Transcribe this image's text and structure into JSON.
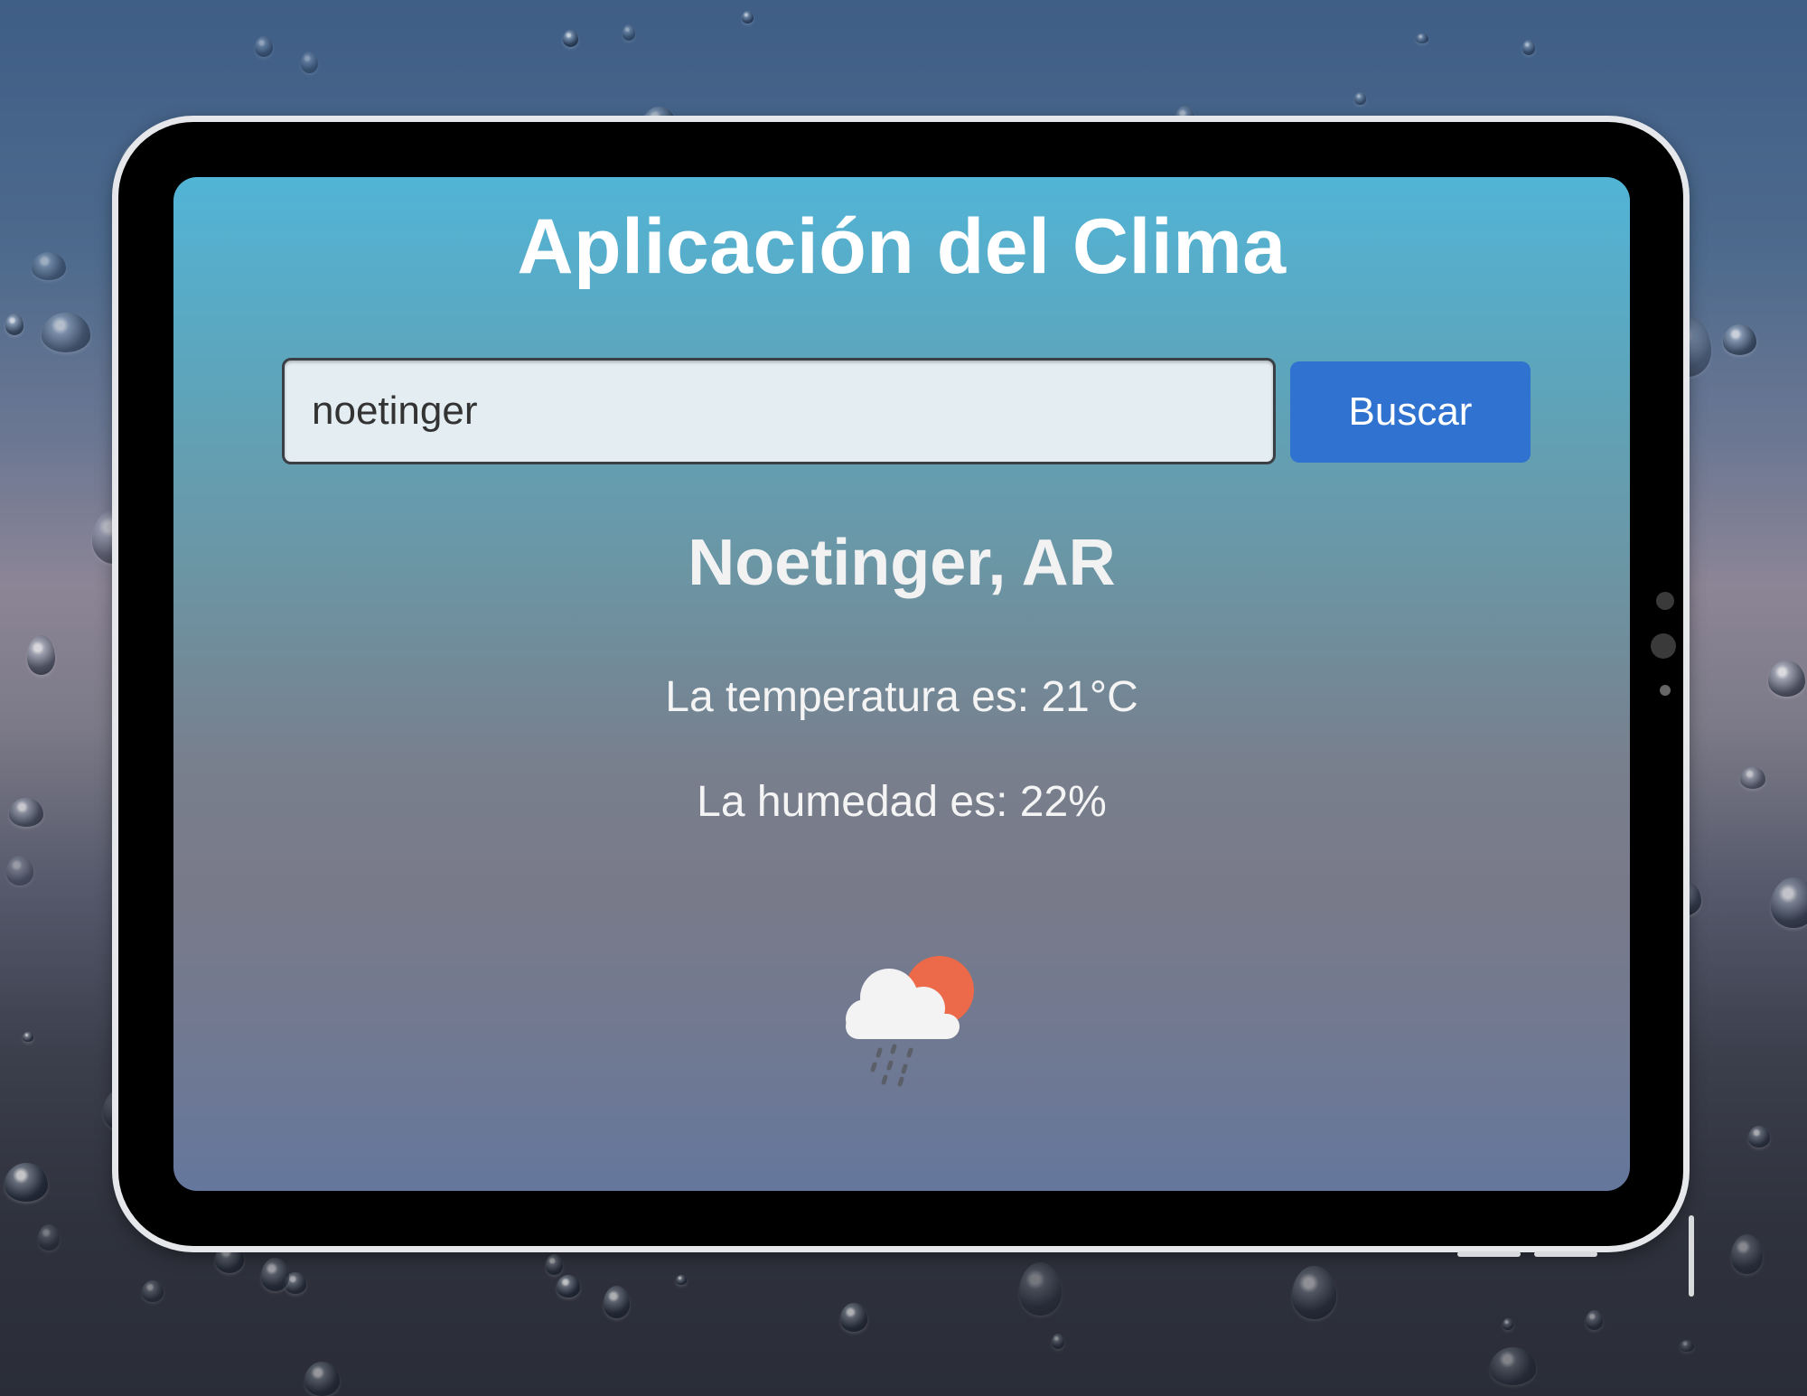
{
  "app": {
    "title": "Aplicación del Clima"
  },
  "search": {
    "value": "noetinger",
    "button_label": "Buscar"
  },
  "weather": {
    "location": "Noetinger, AR",
    "temperature_text": "La temperatura es: 21°C",
    "humidity_text": "La humedad es: 22%",
    "icon": "cloud-sun-rain-icon"
  },
  "colors": {
    "button": "#2f72cf",
    "title_text": "#ffffff",
    "sun": "#ec6a4a",
    "cloud": "#f3f3f3"
  }
}
